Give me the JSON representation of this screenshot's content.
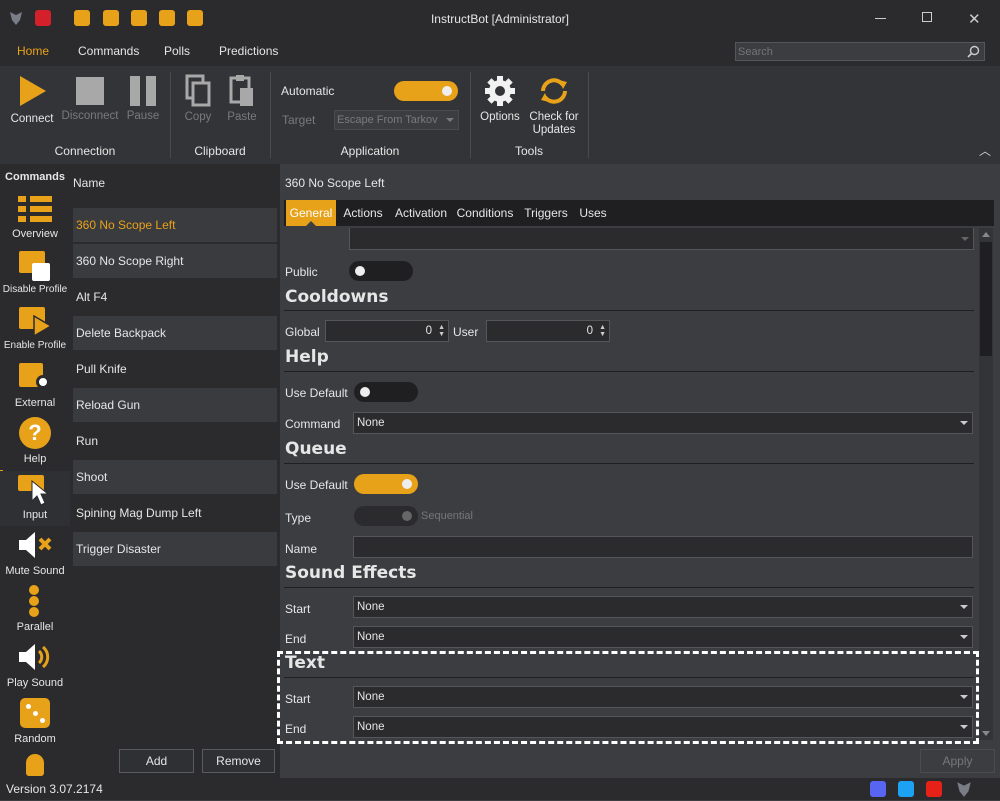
{
  "window": {
    "title": "InstructBot [Administrator]"
  },
  "menu": {
    "items": [
      "Home",
      "Commands",
      "Polls",
      "Predictions"
    ],
    "search_placeholder": "Search"
  },
  "ribbon": {
    "connect": "Connect",
    "disconnect": "Disconnect",
    "pause": "Pause",
    "copy": "Copy",
    "paste": "Paste",
    "automatic_label": "Automatic",
    "target_label": "Target",
    "target_value": "Escape From Tarkov",
    "options": "Options",
    "check_updates": "Check for Updates",
    "groups": {
      "connection": "Connection",
      "clipboard": "Clipboard",
      "application": "Application",
      "tools": "Tools"
    }
  },
  "sidebar": {
    "header": "Commands",
    "items": [
      "Overview",
      "Disable Profile",
      "Enable Profile",
      "External",
      "Help",
      "Input",
      "Mute Sound",
      "Parallel",
      "Play Sound",
      "Random"
    ]
  },
  "list": {
    "header": "Name",
    "items": [
      "360 No Scope Left",
      "360 No Scope Right",
      "Alt F4",
      "Delete Backpack",
      "Pull Knife",
      "Reload Gun",
      "Run",
      "Shoot",
      "Spining Mag Dump Left",
      "Trigger Disaster"
    ],
    "add": "Add",
    "remove": "Remove"
  },
  "editor": {
    "title": "360 No Scope Left",
    "tabs": [
      "General",
      "Actions",
      "Activation",
      "Conditions",
      "Triggers",
      "Uses"
    ],
    "public_label": "Public",
    "cooldowns": {
      "title": "Cooldowns",
      "global_label": "Global",
      "global_value": "0",
      "user_label": "User",
      "user_value": "0"
    },
    "help": {
      "title": "Help",
      "use_default_label": "Use Default",
      "command_label": "Command",
      "command_value": "None"
    },
    "queue": {
      "title": "Queue",
      "use_default_label": "Use Default",
      "type_label": "Type",
      "type_value": "Sequential",
      "name_label": "Name"
    },
    "sound_effects": {
      "title": "Sound Effects",
      "start_label": "Start",
      "start_value": "None",
      "end_label": "End",
      "end_value": "None"
    },
    "text": {
      "title": "Text",
      "start_label": "Start",
      "start_value": "None",
      "end_label": "End",
      "end_value": "None"
    },
    "apply": "Apply"
  },
  "status": {
    "version": "Version 3.07.2174"
  },
  "colors": {
    "accent": "#e8a219",
    "discord": "#5865f2",
    "twitter": "#1da1f2",
    "youtube": "#e62117"
  }
}
